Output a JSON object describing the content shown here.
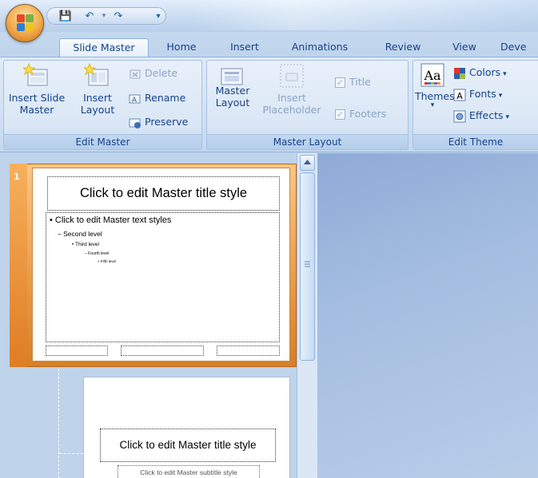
{
  "tabs": [
    {
      "label": "Slide Master",
      "active": true
    },
    {
      "label": "Home"
    },
    {
      "label": "Insert"
    },
    {
      "label": "Animations"
    },
    {
      "label": "Review"
    },
    {
      "label": "View"
    },
    {
      "label": "Deve"
    }
  ],
  "ribbon": {
    "edit_master": {
      "label": "Edit Master",
      "insert_slide_master": "Insert Slide\nMaster",
      "insert_layout": "Insert\nLayout",
      "delete": "Delete",
      "rename": "Rename",
      "preserve": "Preserve"
    },
    "master_layout": {
      "label": "Master Layout",
      "master_layout": "Master\nLayout",
      "insert_placeholder": "Insert\nPlaceholder",
      "title": "Title",
      "footers": "Footers",
      "title_checked": true,
      "footers_checked": true
    },
    "edit_theme": {
      "label": "Edit Theme",
      "themes": "Themes",
      "colors": "Colors",
      "fonts": "Fonts",
      "effects": "Effects"
    }
  },
  "slides": [
    {
      "number": "1",
      "title": "Click to edit Master title style",
      "levels": [
        "Click to edit Master text styles",
        "Second level",
        "Third level",
        "Fourth level",
        "Fifth level"
      ]
    },
    {
      "title": "Click to edit Master title style",
      "subtitle": "Click to edit Master subtitle style"
    }
  ],
  "colors": {
    "ribbon_text": "#15428b",
    "selection_orange": "#e99a43"
  }
}
